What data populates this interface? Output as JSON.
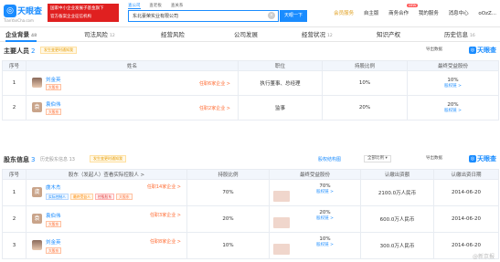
{
  "header": {
    "logo_text": "天眼查",
    "logo_sub": "TianYanCha.com",
    "promo_lines": [
      "国家中小企业发展子基金旗下",
      "官方备案企业征信机构"
    ],
    "search_tabs": [
      "查公司",
      "查老板",
      "查关系"
    ],
    "search_value": "东北豪荣实业有限公司",
    "search_button": "天眼一下",
    "nav": [
      "会员服务",
      "自主版",
      "商务合作",
      "我的服务",
      "消息中心",
      "oOzZ..."
    ],
    "nav_badge": "NEW"
  },
  "tabs": [
    {
      "label": "企业背景",
      "count": "48"
    },
    {
      "label": "司法风险",
      "count": "12"
    },
    {
      "label": "经营风险",
      "count": ""
    },
    {
      "label": "公司发展",
      "count": ""
    },
    {
      "label": "经营状况",
      "count": "12"
    },
    {
      "label": "知识产权",
      "count": ""
    },
    {
      "label": "历史信息",
      "count": "16"
    }
  ],
  "key_personnel": {
    "title": "主要人员",
    "count": "2",
    "tip": "发生变更时通知我",
    "export": "导出数据",
    "brand": "天眼查",
    "columns": [
      "序号",
      "姓名",
      "职位",
      "持股比例",
      "最终受益股份"
    ],
    "rows": [
      {
        "idx": "1",
        "name": "刘金英",
        "avatar": "",
        "tags": [
          "大股东"
        ],
        "assoc": "任职6家企业 >",
        "position": "执行董事、总经理",
        "ratio": "10%",
        "benefit": "10%",
        "benefit_link": "股权链 >"
      },
      {
        "idx": "2",
        "name": "袁伯伟",
        "avatar": "袁",
        "tags": [
          "大股东"
        ],
        "assoc": "任职2家企业 >",
        "position": "监事",
        "ratio": "20%",
        "benefit": "20%",
        "benefit_link": "股权链 >"
      }
    ]
  },
  "shareholders": {
    "title": "股东信息",
    "count": "3",
    "history": "历史股东信息 13",
    "tip": "发生变更时通知我",
    "link": "股权结构图",
    "select": "全部比例",
    "export": "导出数据",
    "brand": "天眼查",
    "columns": [
      "序号",
      "股东（发起人）查看实际控股人 >",
      "持股比例",
      "最终受益股份",
      "认缴出资额",
      "认缴出资日期"
    ],
    "rows": [
      {
        "idx": "1",
        "name": "虞木杰",
        "avatar": "虞",
        "tags": [
          "实际控制人",
          "最终受益人",
          "控股股东",
          "大股东"
        ],
        "assoc": "任职14家企业 >",
        "ratio": "70%",
        "benefit": "70%",
        "benefit_link": "股权链 >",
        "amount": "2100.0万人民币",
        "date": "2014-06-20"
      },
      {
        "idx": "2",
        "name": "袁伯伟",
        "avatar": "袁",
        "tags": [
          "大股东"
        ],
        "assoc": "任职3家企业 >",
        "ratio": "20%",
        "benefit": "20%",
        "benefit_link": "股权链 >",
        "amount": "600.0万人民币",
        "date": "2014-06-20"
      },
      {
        "idx": "3",
        "name": "刘金英",
        "avatar": "",
        "tags": [
          "大股东"
        ],
        "assoc": "任职8家企业 >",
        "ratio": "10%",
        "benefit": "10%",
        "benefit_link": "股权链 >",
        "amount": "300.0万人民币",
        "date": "2014-06-20"
      }
    ]
  },
  "watermark": "@新京报"
}
